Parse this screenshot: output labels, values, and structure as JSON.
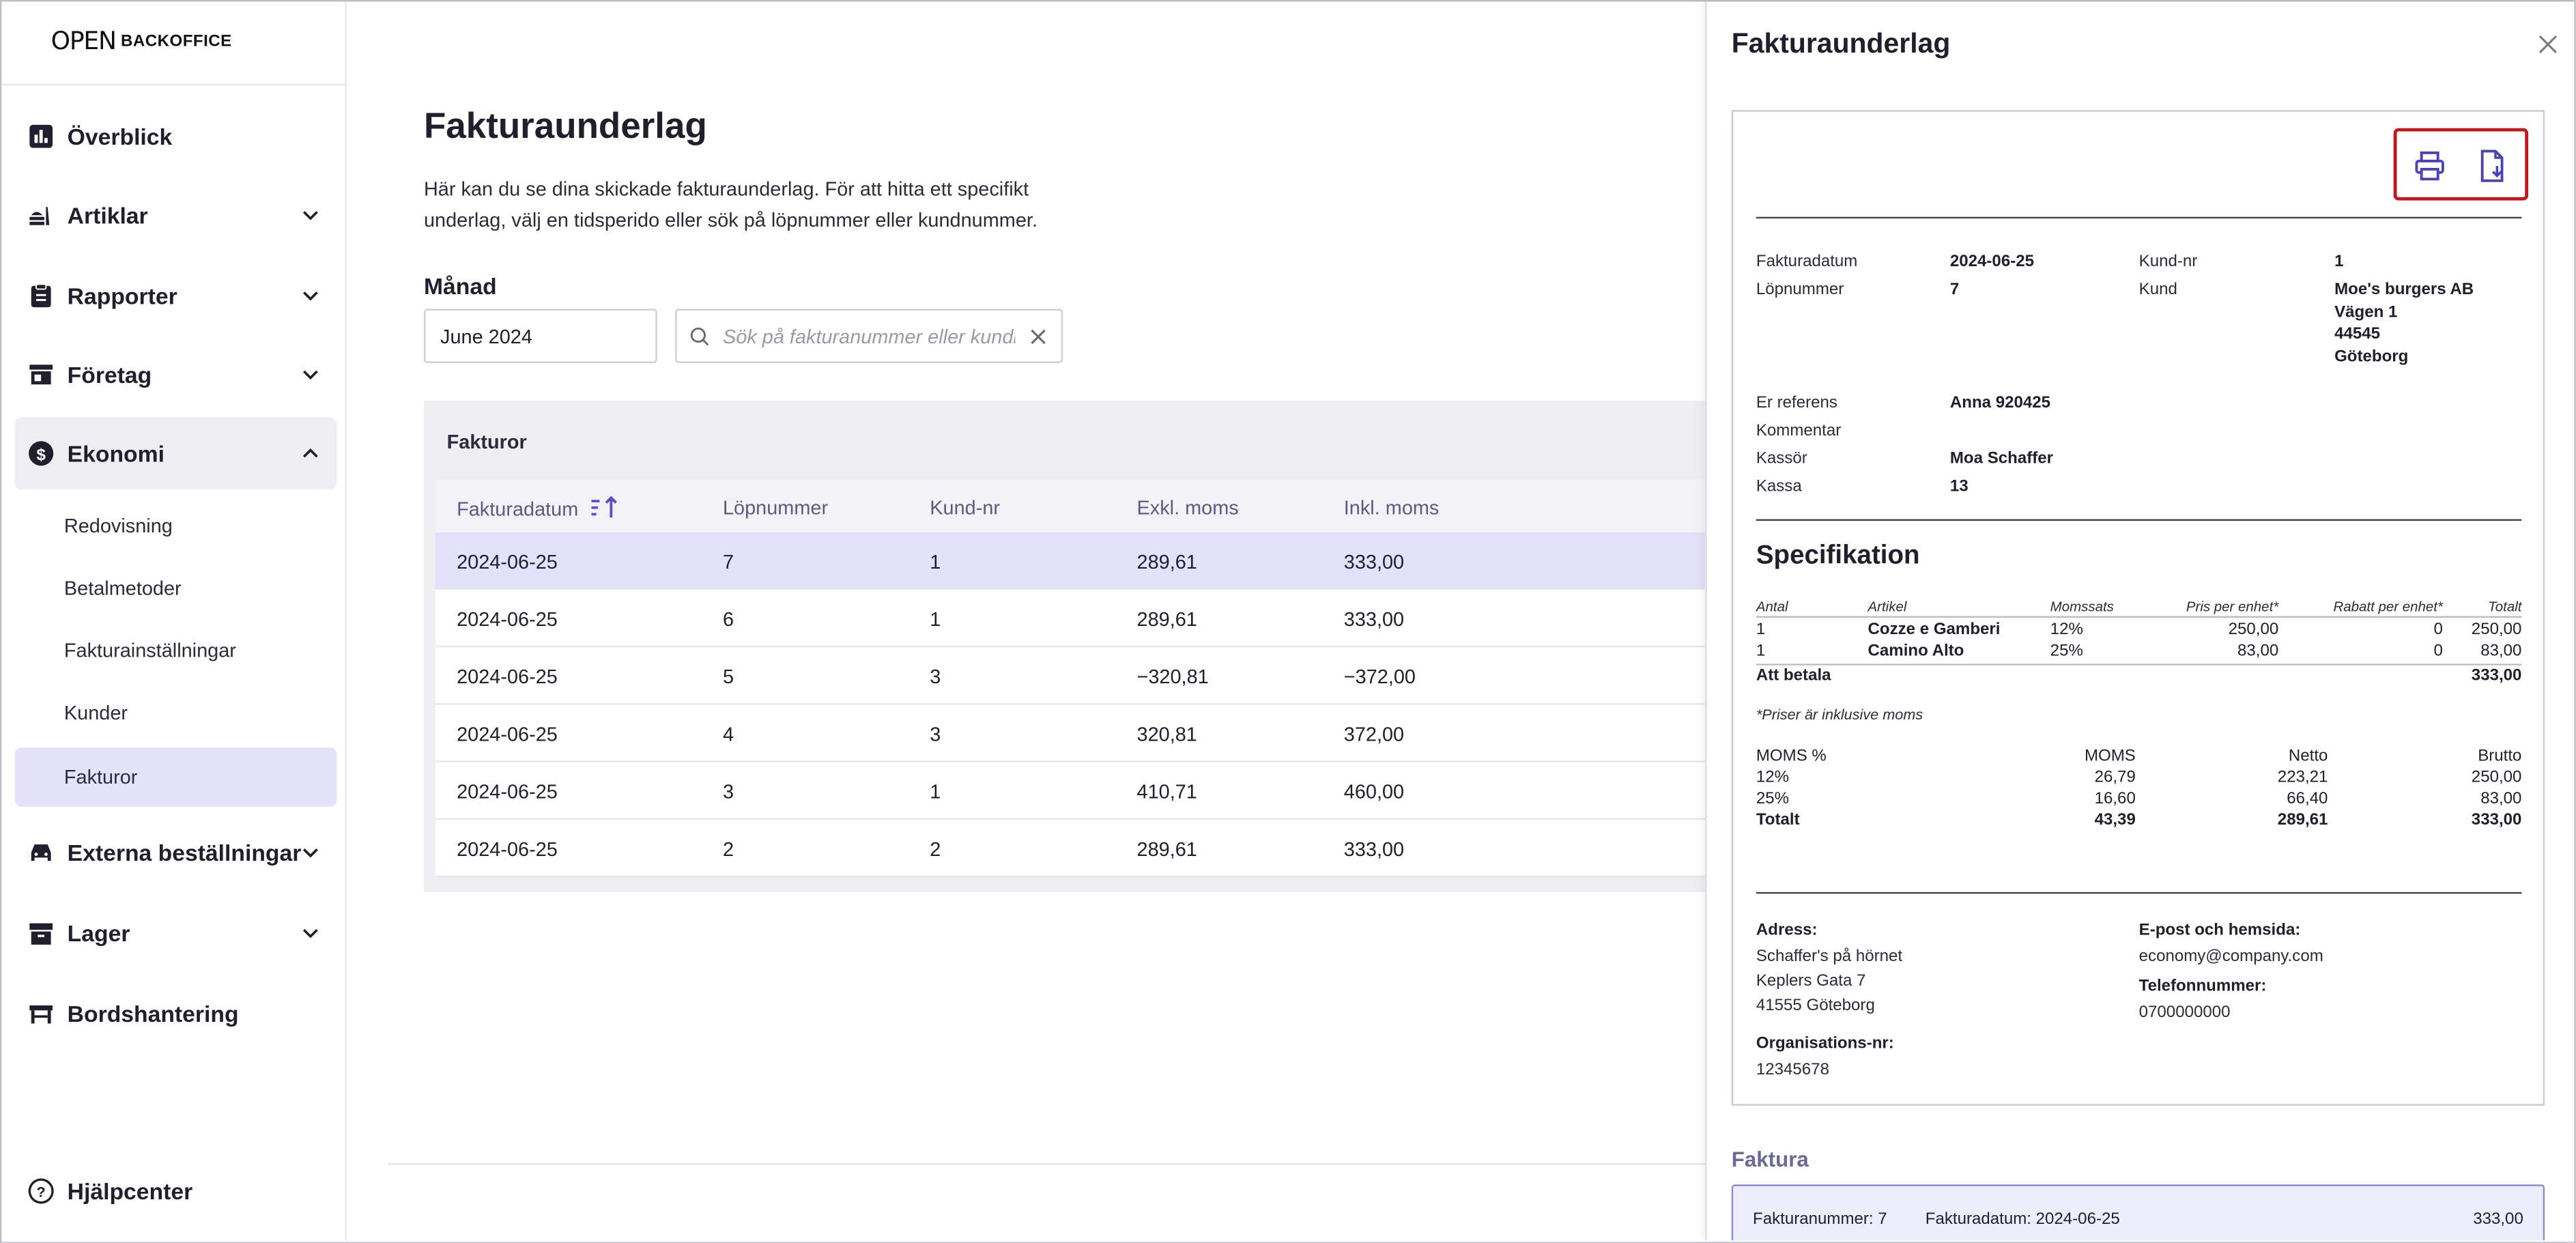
{
  "app": {
    "logo_mark": "OPEN",
    "logo_text": "BACKOFFICE"
  },
  "sidebar": {
    "items": [
      {
        "label": "Överblick",
        "icon": "bar-chart-icon"
      },
      {
        "label": "Artiklar",
        "icon": "food-icon"
      },
      {
        "label": "Rapporter",
        "icon": "clipboard-icon"
      },
      {
        "label": "Företag",
        "icon": "store-icon"
      },
      {
        "label": "Ekonomi",
        "icon": "dollar-icon"
      },
      {
        "label": "Externa beställningar",
        "icon": "car-icon"
      },
      {
        "label": "Lager",
        "icon": "archive-icon"
      },
      {
        "label": "Bordshantering",
        "icon": "table-icon"
      }
    ],
    "sub_items": [
      "Redovisning",
      "Betalmetoder",
      "Fakturainställningar",
      "Kunder",
      "Fakturor"
    ],
    "help": "Hjälpcenter"
  },
  "main": {
    "title": "Fakturaunderlag",
    "description": "Här kan du se dina skickade fakturaunderlag. För att hitta ett specifikt underlag, välj en tidsperido eller sök på löpnummer eller kundnummer.",
    "month_label": "Månad",
    "month_value": "June 2024",
    "search_placeholder": "Sök på fakturanummer eller kundnummer",
    "table_title": "Fakturor",
    "columns": [
      "Fakturadatum",
      "Löpnummer",
      "Kund-nr",
      "Exkl. moms",
      "Inkl. moms"
    ],
    "rows": [
      [
        "2024-06-25",
        "7",
        "1",
        "289,61",
        "333,00"
      ],
      [
        "2024-06-25",
        "6",
        "1",
        "289,61",
        "333,00"
      ],
      [
        "2024-06-25",
        "5",
        "3",
        "−320,81",
        "−372,00"
      ],
      [
        "2024-06-25",
        "4",
        "3",
        "320,81",
        "372,00"
      ],
      [
        "2024-06-25",
        "3",
        "1",
        "410,71",
        "460,00"
      ],
      [
        "2024-06-25",
        "2",
        "2",
        "289,61",
        "333,00"
      ]
    ]
  },
  "drawer": {
    "title": "Fakturaunderlag",
    "meta": {
      "fakturadatum_label": "Fakturadatum",
      "fakturadatum": "2024-06-25",
      "lopnummer_label": "Löpnummer",
      "lopnummer": "7",
      "kundnr_label": "Kund-nr",
      "kundnr": "1",
      "kund_label": "Kund",
      "kund_lines": [
        "Moe's burgers AB",
        "Vägen 1",
        "44545",
        "Göteborg"
      ],
      "er_referens_label": "Er referens",
      "er_referens": "Anna 920425",
      "kommentar_label": "Kommentar",
      "kassor_label": "Kassör",
      "kassor": "Moa Schaffer",
      "kassa_label": "Kassa",
      "kassa": "13"
    },
    "spec": {
      "title": "Specifikation",
      "headers": [
        "Antal",
        "Artikel",
        "Momssats",
        "Pris per enhet*",
        "Rabatt per enhet*",
        "Totalt"
      ],
      "rows": [
        [
          "1",
          "Cozze e Gamberi",
          "12%",
          "250,00",
          "0",
          "250,00"
        ],
        [
          "1",
          "Camino Alto",
          "25%",
          "83,00",
          "0",
          "83,00"
        ]
      ],
      "att_betala_label": "Att betala",
      "att_betala": "333,00",
      "note": "*Priser är inklusive moms",
      "vat_headers": [
        "MOMS %",
        "MOMS",
        "Netto",
        "Brutto"
      ],
      "vat_rows": [
        [
          "12%",
          "26,79",
          "223,21",
          "250,00"
        ],
        [
          "25%",
          "16,60",
          "66,40",
          "83,00"
        ]
      ],
      "vat_total": [
        "Totalt",
        "43,39",
        "289,61",
        "333,00"
      ]
    },
    "footer": {
      "adress_label": "Adress:",
      "adress_lines": [
        "Schaffer's på hörnet",
        "Keplers Gata 7",
        "41555 Göteborg"
      ],
      "org_label": "Organisations-nr:",
      "org": "12345678",
      "email_label": "E-post och hemsida:",
      "email": "economy@company.com",
      "phone_label": "Telefonnummer:",
      "phone": "0700000000"
    },
    "faktura_heading": "Faktura",
    "faktura_row": {
      "nummer": "Fakturanummer: 7",
      "datum": "Fakturadatum: 2024-06-25",
      "belopp": "333,00"
    }
  },
  "colors": {
    "accent": "#5b4fc4",
    "selected_row": "#e4e2fa",
    "highlight_border": "#c4171d"
  }
}
